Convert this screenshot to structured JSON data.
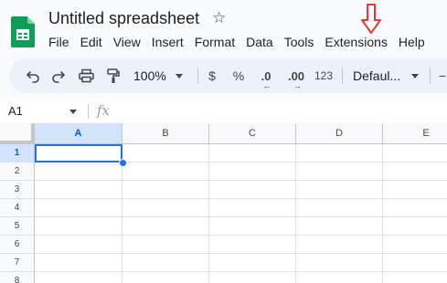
{
  "document": {
    "title": "Untitled spreadsheet"
  },
  "menu": {
    "items": [
      "File",
      "Edit",
      "View",
      "Insert",
      "Format",
      "Data",
      "Tools",
      "Extensions",
      "Help"
    ]
  },
  "annotation": {
    "arrow_color": "#e53935",
    "points_to": "Extensions"
  },
  "toolbar": {
    "zoom": "100%",
    "currency_symbol": "$",
    "percent_symbol": "%",
    "decrease_decimal": ".0",
    "increase_decimal": ".00",
    "number_format": "123",
    "font": "Defaul..."
  },
  "formula_bar": {
    "cell_reference": "A1",
    "fx_label": "fx",
    "formula": ""
  },
  "grid": {
    "columns": [
      "A",
      "B",
      "C",
      "D",
      "E"
    ],
    "rows": [
      "1",
      "2",
      "3",
      "4",
      "5",
      "6",
      "7",
      "8"
    ],
    "selected_cell": "A1",
    "selection_color": "#1a73e8"
  },
  "colors": {
    "brand_green": "#0f9d58",
    "toolbar_bg": "#edf2fa",
    "selected_header_bg": "#d3e3fd"
  }
}
